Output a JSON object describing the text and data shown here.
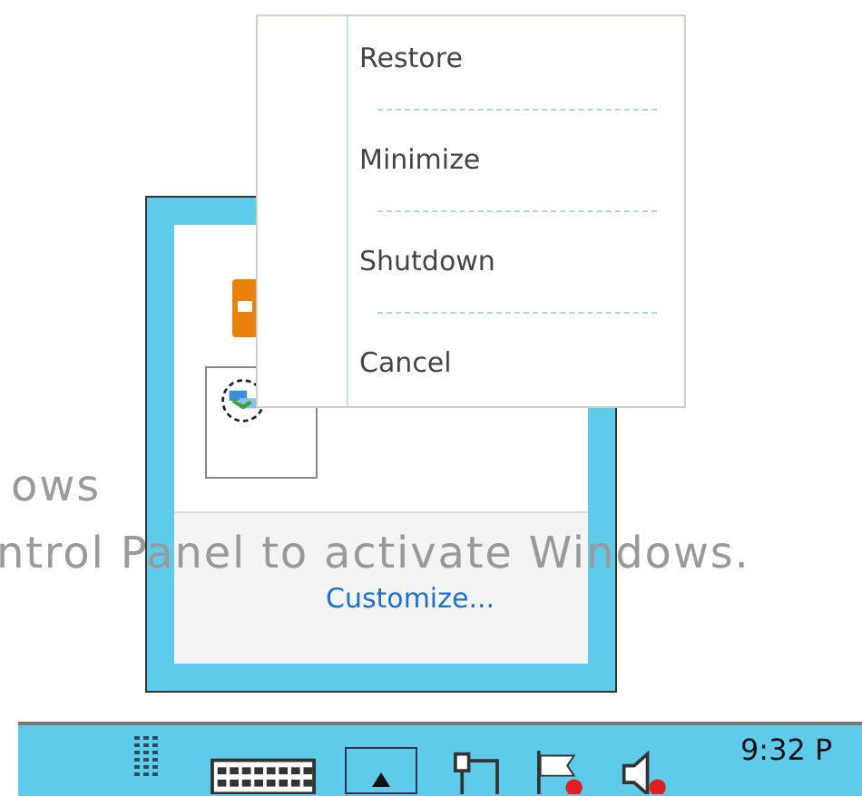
{
  "desktop_watermark": {
    "lines": [
      "ows",
      "ntrol Panel to activate Windows."
    ]
  },
  "tray_flyout": {
    "link": "Customize..."
  },
  "context_menu": {
    "items": [
      {
        "label": "Restore"
      },
      {
        "label": "Minimize"
      },
      {
        "label": "Shutdown"
      },
      {
        "label": "Cancel"
      }
    ]
  },
  "taskbar": {
    "clock": "9:32 P"
  }
}
